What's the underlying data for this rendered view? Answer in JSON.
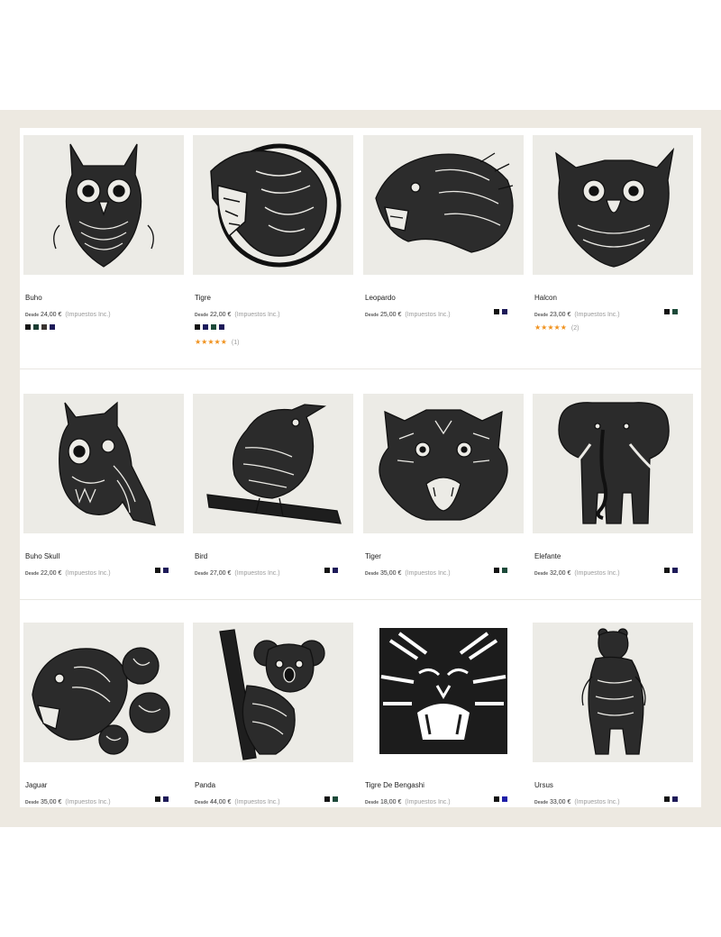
{
  "products": [
    {
      "id": "p1",
      "name": "Buho",
      "desde": "Desde",
      "price": "24,00 €",
      "tax": "(Impuestos Inc.)",
      "swatches": [
        "#141414",
        "#1b3d33",
        "#3a3430",
        "#1e1b59"
      ],
      "swatch_layout": "below",
      "rating_stars": "",
      "rating_count": "",
      "illustration": "owl-icon"
    },
    {
      "id": "p2",
      "name": "Tigre",
      "desde": "Desde",
      "price": "22,00 €",
      "tax": "(Impuestos Inc.)",
      "swatches": [
        "#141414",
        "#1b1b5c",
        "#1d4a3a",
        "#1e1b59"
      ],
      "swatch_layout": "below",
      "rating_stars": "★★★★★",
      "rating_count": "(1)",
      "illustration": "tiger-circle-icon"
    },
    {
      "id": "p3",
      "name": "Leopardo",
      "desde": "Desde",
      "price": "25,00 €",
      "tax": "(Impuestos Inc.)",
      "swatches": [
        "#141414",
        "#1e1b59"
      ],
      "swatch_layout": "inline",
      "rating_stars": "",
      "rating_count": "",
      "illustration": "leopard-icon"
    },
    {
      "id": "p4",
      "name": "Halcon",
      "desde": "Desde",
      "price": "23,00 €",
      "tax": "(Impuestos Inc.)",
      "swatches": [
        "#141414",
        "#1d4a3a"
      ],
      "swatch_layout": "inline",
      "rating_stars": "★★★★★",
      "rating_count": "(2)",
      "illustration": "hawk-icon"
    },
    {
      "id": "p5",
      "name": "Buho Skull",
      "desde": "Desde",
      "price": "22,00 €",
      "tax": "(Impuestos Inc.)",
      "swatches": [
        "#141414",
        "#1e1b59"
      ],
      "swatch_layout": "inline",
      "rating_stars": "",
      "rating_count": "",
      "illustration": "owl-skull-icon"
    },
    {
      "id": "p6",
      "name": "Bird",
      "desde": "Desde",
      "price": "27,00 €",
      "tax": "(Impuestos Inc.)",
      "swatches": [
        "#141414",
        "#1e1b59"
      ],
      "swatch_layout": "inline",
      "rating_stars": "",
      "rating_count": "",
      "illustration": "bird-icon"
    },
    {
      "id": "p7",
      "name": "Tiger",
      "desde": "Desde",
      "price": "35,00 €",
      "tax": "(Impuestos Inc.)",
      "swatches": [
        "#141414",
        "#1d4a3a"
      ],
      "swatch_layout": "inline",
      "rating_stars": "",
      "rating_count": "",
      "illustration": "tiger-icon"
    },
    {
      "id": "p8",
      "name": "Elefante",
      "desde": "Desde",
      "price": "32,00 €",
      "tax": "(Impuestos Inc.)",
      "swatches": [
        "#141414",
        "#1e1b59"
      ],
      "swatch_layout": "inline",
      "rating_stars": "",
      "rating_count": "",
      "illustration": "elephant-icon"
    },
    {
      "id": "p9",
      "name": "Jaguar",
      "desde": "Desde",
      "price": "35,00 €",
      "tax": "(Impuestos Inc.)",
      "swatches": [
        "#141414",
        "#1e1b59"
      ],
      "swatch_layout": "inline",
      "rating_stars": "",
      "rating_count": "",
      "illustration": "jaguar-icon"
    },
    {
      "id": "p10",
      "name": "Panda",
      "desde": "Desde",
      "price": "44,00 €",
      "tax": "(Impuestos Inc.)",
      "swatches": [
        "#141414",
        "#1d4a3a"
      ],
      "swatch_layout": "inline",
      "rating_stars": "",
      "rating_count": "",
      "illustration": "koala-icon"
    },
    {
      "id": "p11",
      "name": "Tigre De Bengashi",
      "desde": "Desde",
      "price": "18,00 €",
      "tax": "(Impuestos Inc.)",
      "swatches": [
        "#141414",
        "#1f1fa8"
      ],
      "swatch_layout": "inline",
      "rating_stars": "",
      "rating_count": "",
      "illustration": "bengal-tiger-icon"
    },
    {
      "id": "p12",
      "name": "Ursus",
      "desde": "Desde",
      "price": "33,00 €",
      "tax": "(Impuestos Inc.)",
      "swatches": [
        "#141414",
        "#1e1b59"
      ],
      "swatch_layout": "inline",
      "rating_stars": "",
      "rating_count": "",
      "illustration": "bear-icon"
    }
  ]
}
